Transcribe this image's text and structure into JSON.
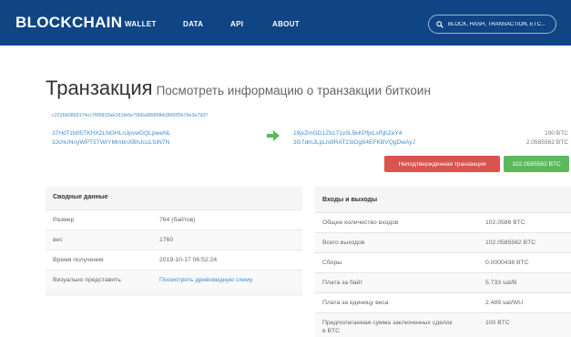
{
  "header": {
    "logo": "BLOCKCHAIN",
    "nav": [
      {
        "label": "WALLET"
      },
      {
        "label": "DATA"
      },
      {
        "label": "API"
      },
      {
        "label": "ABOUT"
      }
    ],
    "search_placeholder": "BLOCK, HASH, TRANSACTION, ETC...",
    "bg_color": "#0f4585"
  },
  "page": {
    "title": "Транзакция",
    "subtitle": "Посмотреть информацию о транзакции биткоин"
  },
  "transaction": {
    "hash": "c2226b0869174cc76f5833ab161fe5e79b6a98d99bb3b66f5b79e3e7d37",
    "inputs": [
      "37HdTzb05TKHX2LNGHLnJpvwGQLpweNL",
      "3JchUNnyWPT5TWrYMmbnXBhJcuLSiN7N"
    ],
    "outputs": [
      {
        "address": "19jxZmGD1Zb171v3L5kKPfjxLsRjhZeY4",
        "amount": "100 BTC"
      },
      {
        "address": "3G7dmJLpLts9RAT23iGgS4EFKBVQgDwAyJ",
        "amount": "2.0585562 BTC"
      }
    ],
    "status_label": "Неподтвержденная транзакция",
    "total_label": "102.0585562 BTC",
    "status_color": "#d9534f",
    "total_color": "#5cb85c"
  },
  "summary": {
    "heading": "Сводные данные",
    "rows": [
      {
        "label": "Размер",
        "value": "764 (байтов)"
      },
      {
        "label": "вес",
        "value": "1760"
      },
      {
        "label": "Время получения",
        "value": "2019-10-17 06:52:24"
      },
      {
        "label": "Визуально представить",
        "value": "Посмотреть древовидную схему"
      }
    ]
  },
  "io": {
    "heading": "Входы и выходы",
    "rows": [
      {
        "label": "Общее количество входов",
        "value": "102.0586 BTC"
      },
      {
        "label": "Всего выходов",
        "value": "102.0585562 BTC"
      },
      {
        "label": "Сборы",
        "value": "0.0000438 BTC"
      },
      {
        "label": "Плата за байт",
        "value": "5.733 sat/B"
      },
      {
        "label": "Плата за единицу веса",
        "value": "2.489 sat/WU"
      },
      {
        "label": "Предполагаемая сумма заключенных сделок",
        "label_line2": "в BTC",
        "value": "100 BTC"
      }
    ]
  },
  "icons": {
    "search": "search-icon",
    "arrow": "arrow-right-icon"
  }
}
